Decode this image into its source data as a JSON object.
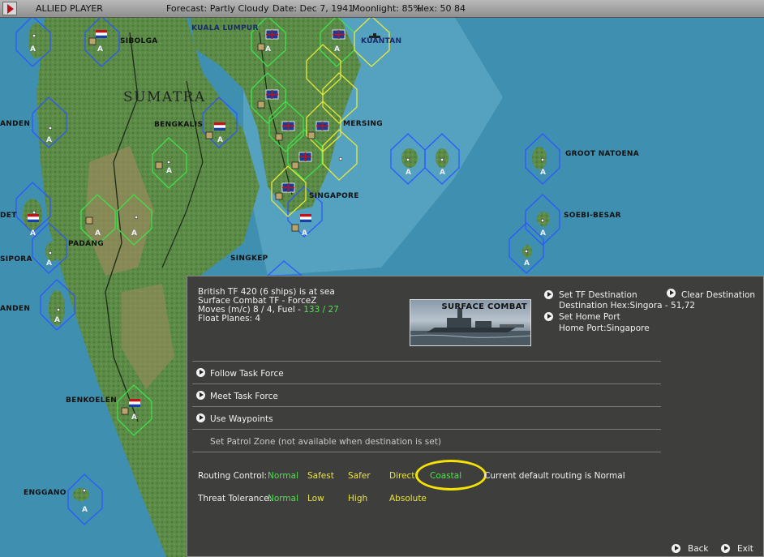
{
  "topbar": {
    "player": "ALLIED PLAYER",
    "forecast": "Forecast: Partly Cloudy",
    "date": "Date: Dec 7, 1941",
    "moonlight": "Moonlight: 85%",
    "hex": "Hex: 50 84"
  },
  "map": {
    "labels": {
      "sibolga": "SIBOLGA",
      "kuala_lumpur": "KUALA LUMPUR",
      "kuantan": "KUANTAN",
      "sumatra": "SUMATRA",
      "bengkalis": "BENGKALIS",
      "mersing": "MERSING",
      "groot_natoena": "GROOT NATOENA",
      "singapore": "SINGAPORE",
      "soebi_besar": "SOEBI-BESAR",
      "padang": "PADANG",
      "singkep": "SINGKEP",
      "sipora": "SIPORA",
      "anden_1": "ANDEN",
      "anden_2": "ANDEN",
      "det": "DET",
      "benkoelen": "BENKOELEN",
      "enggano": "ENGGANO"
    },
    "unit_letter": "A",
    "colors": {
      "sea": "#3f8fb0",
      "land": "#5e8a4a",
      "friendly_hex": "#3a6bff",
      "green_hex": "#4ce04c",
      "yellow_hex": "#ecec3c"
    }
  },
  "panel": {
    "info": {
      "line1": "British TF 420 (6 ships) is at sea",
      "line2": "Surface Combat TF - ForceZ",
      "moves_prefix": "Moves (m/c)  8 / 4, Fuel - ",
      "fuel_value": "133 / 27",
      "float_planes": "Float Planes:  4"
    },
    "picture_title": "SURFACE COMBAT",
    "set_destination": "Set TF Destination",
    "destination_hex": "Destination Hex:Singora - 51,72",
    "clear_destination": "Clear Destination",
    "set_home_port": "Set Home Port",
    "home_port": "Home Port:Singapore",
    "actions": {
      "follow": "Follow Task Force",
      "meet": "Meet Task Force",
      "waypoints": "Use Waypoints",
      "patrol": "Set Patrol Zone  (not available when destination is set)"
    },
    "routing": {
      "label": "Routing Control:",
      "options": [
        "Normal",
        "Safest",
        "Safer",
        "Direct",
        "Coastal"
      ],
      "current": "Current default routing  is  Normal"
    },
    "threat": {
      "label": "Threat Tolerance:",
      "options": [
        "Normal",
        "Low",
        "High",
        "Absolute"
      ]
    },
    "back": "Back",
    "exit": "Exit",
    "colors": {
      "panel_bg": "#3e3e3c",
      "green_text": "#52e052",
      "yellow_text": "#e8e24a",
      "highlight_ring": "#f4e400"
    }
  }
}
